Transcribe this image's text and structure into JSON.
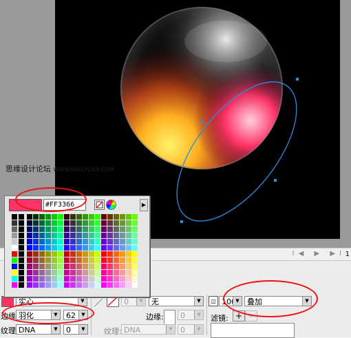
{
  "watermark": {
    "text": "思缘设计论坛",
    "url": "WWW.MISSYUAN.COM"
  },
  "swatch_popup": {
    "hex_value": "#FF3366",
    "selected_color": "#FF3366",
    "no_color_icon": "no-color-icon",
    "color_picker_icon": "color-wheel-icon",
    "expand_icon": "triangle-right-icon"
  },
  "properties": {
    "fill_color": "#FF3366",
    "fill_type": "实心",
    "edge_label": "边缘:",
    "edge_value": "羽化",
    "feather_amount": "62",
    "texture_label": "纹理:",
    "texture_value": "DNA",
    "texture_amount": "0",
    "stroke_size": "0",
    "stroke_type": "无",
    "stroke_edge_label": "边缘:",
    "stroke_edge_value": "0",
    "stroke_texture_label": "纹理:",
    "stroke_texture_value": "DNA",
    "stroke_texture_amount": "0",
    "opacity": "100",
    "blend_mode": "叠加",
    "filters_label": "滤镜:",
    "add_filter": "+",
    "remove_filter": "−"
  },
  "timeline": {
    "controls": "I◀ ▶ ▶I",
    "frame": "1"
  }
}
